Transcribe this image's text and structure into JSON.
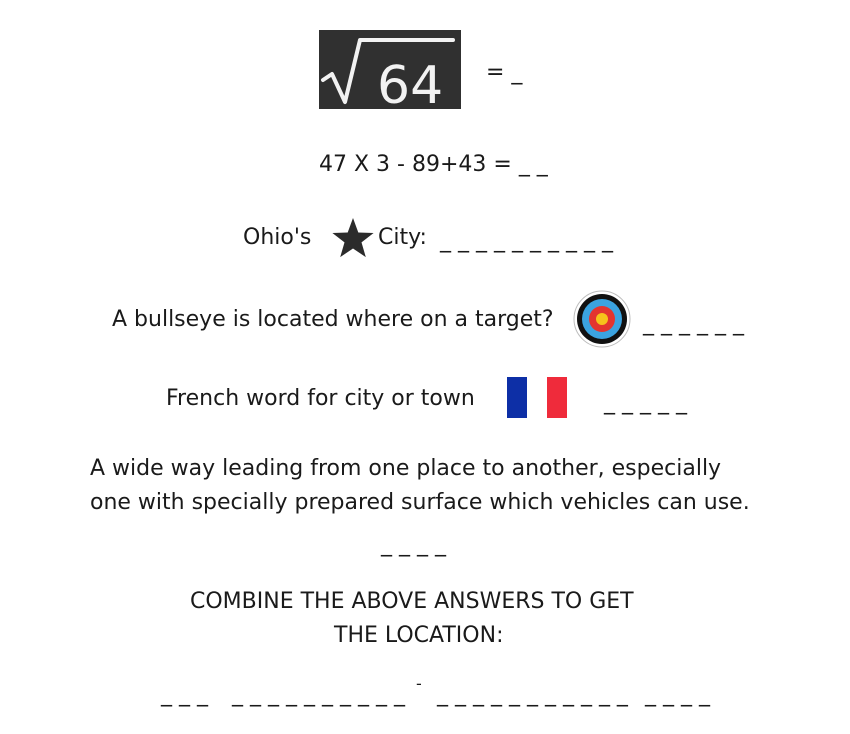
{
  "q1": {
    "radicand": "64",
    "answer": "= _"
  },
  "q2": {
    "text": "47 X 3 - 89+43 = _ _"
  },
  "q3": {
    "prefix": "Ohio's",
    "suffix": "City:",
    "blanks": "_ _ _ _ _ _ _ _ _ _"
  },
  "q4": {
    "text": "A bullseye is located where on a target?",
    "blanks": "_ _ _ _ _ _"
  },
  "q5": {
    "text": "French word for city or town",
    "blanks": "_ _ _ _ _"
  },
  "q6": {
    "line1": "A wide way leading from one place to another, especially",
    "line2": "one with specially prepared surface which vehicles can use.",
    "blanks": "_ _ _ _"
  },
  "combine": {
    "line1": "COMBINE THE ABOVE ANSWERS TO GET",
    "line2": "THE LOCATION:",
    "blanks_a": "_ _ _",
    "blanks_b": "_ _ _ _ _ _ _ _ _ _",
    "dash": "-",
    "blanks_c": "_ _ _ _ _ _ _ _ _ _ _",
    "blanks_d": "_ _ _ _"
  },
  "colors": {
    "chalkboard": "#303030",
    "chalk": "#f2f2f2",
    "flag_blue": "#0d2fa6",
    "flag_white": "#ffffff",
    "flag_red": "#ef2b3b",
    "target_blue": "#3ba3e0",
    "target_red": "#e3342f",
    "target_yellow": "#f6c21b",
    "target_black": "#111111",
    "star": "#2b2b2b"
  }
}
